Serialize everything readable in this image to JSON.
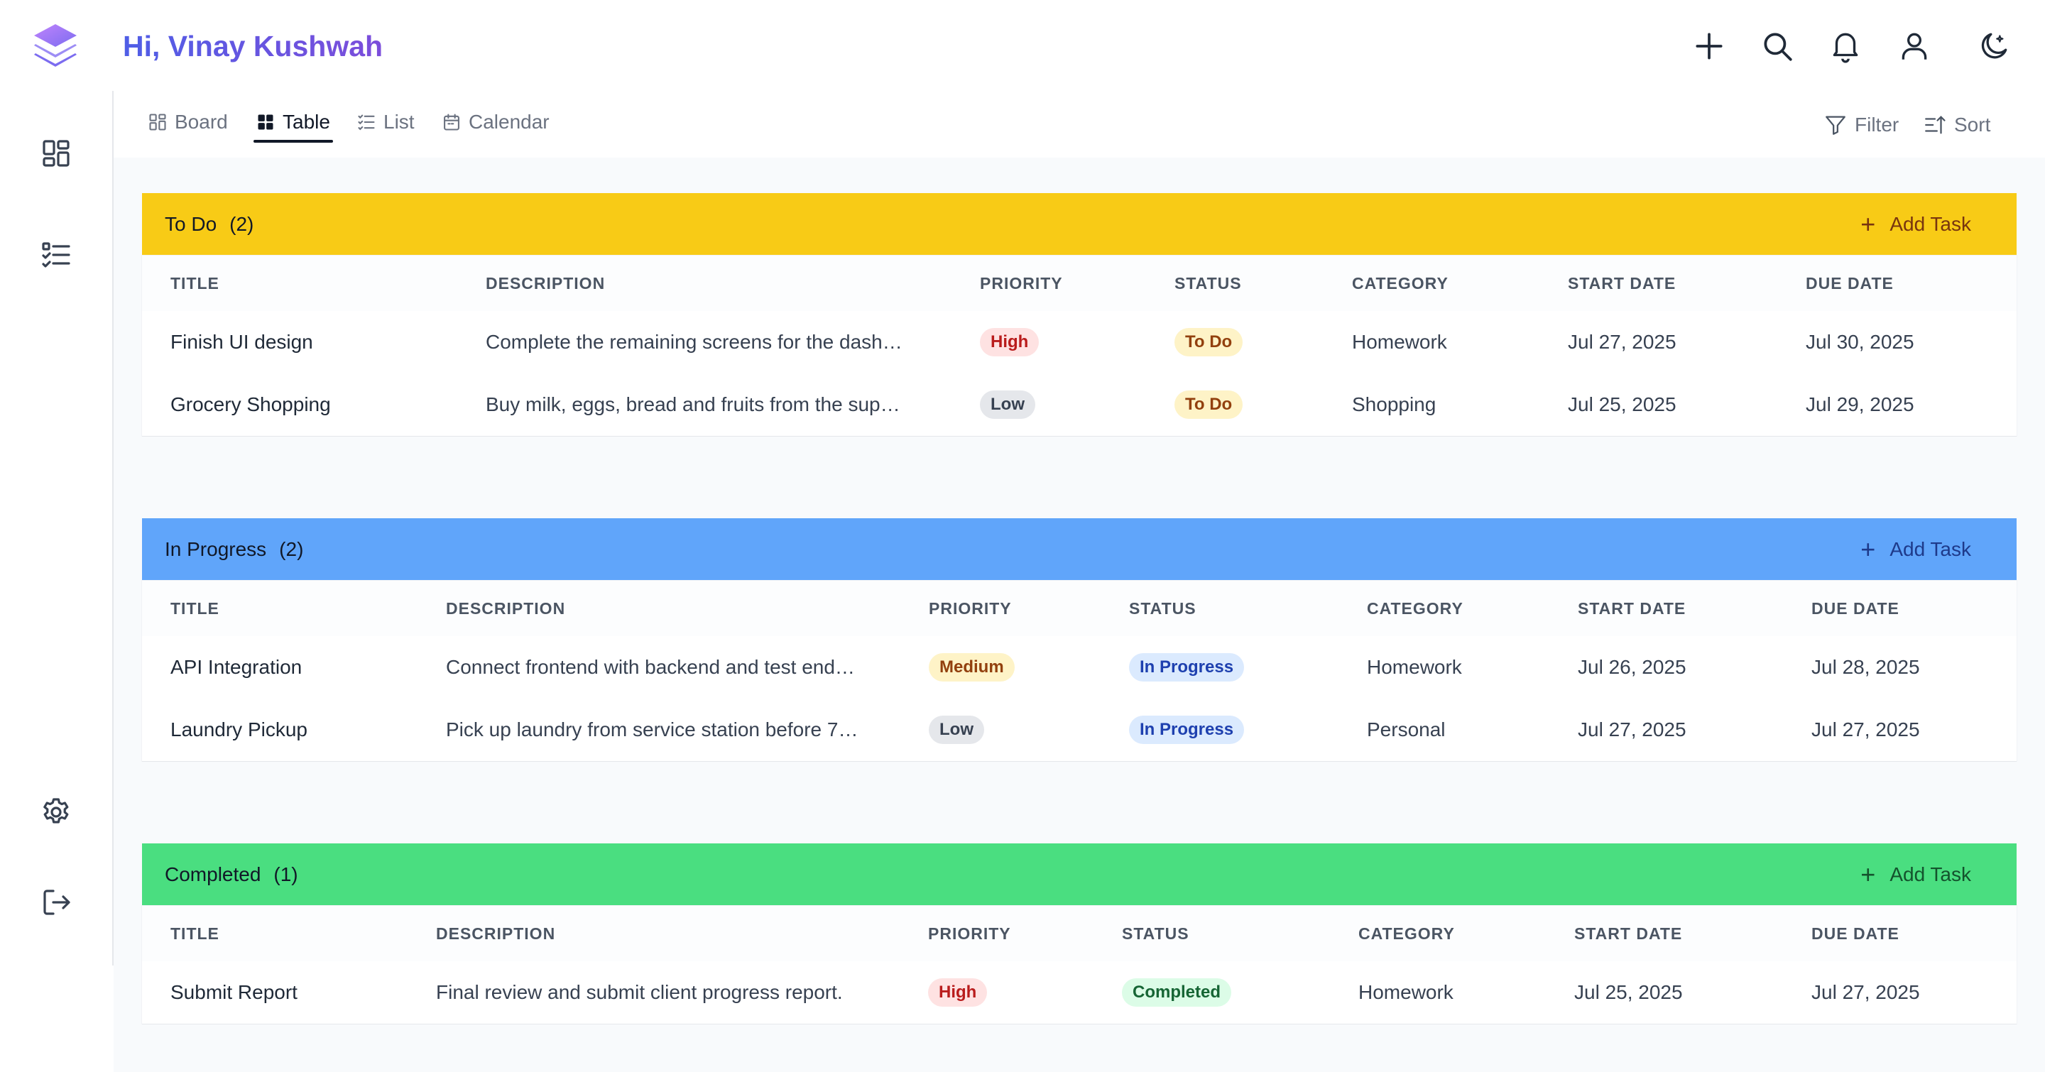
{
  "header": {
    "greeting": "Hi, Vinay Kushwah"
  },
  "header_icons": [
    "plus-icon",
    "search-icon",
    "bell-icon",
    "user-icon",
    "moon-icon"
  ],
  "sidebar_icons": [
    "dashboard-grid-icon",
    "task-list-icon",
    "settings-gear-icon",
    "logout-icon"
  ],
  "tabs": [
    {
      "label": "Board",
      "icon": "board-icon",
      "active": false
    },
    {
      "label": "Table",
      "icon": "table-icon",
      "active": true
    },
    {
      "label": "List",
      "icon": "list-icon",
      "active": false
    },
    {
      "label": "Calendar",
      "icon": "calendar-icon",
      "active": false
    }
  ],
  "toolbar": {
    "filter_label": "Filter",
    "sort_label": "Sort"
  },
  "columns": [
    "TITLE",
    "DESCRIPTION",
    "PRIORITY",
    "STATUS",
    "CATEGORY",
    "START DATE",
    "DUE DATE"
  ],
  "add_task_label": "Add Task",
  "colors": {
    "todo_header": "#f8cb16",
    "in_progress_header": "#60a5fa",
    "completed_header": "#4ade80",
    "priority_high_bg": "#fee2e2",
    "priority_high_fg": "#b91c1c",
    "priority_medium_bg": "#fef3c7",
    "priority_medium_fg": "#92400e",
    "priority_low_bg": "#e5e7eb",
    "priority_low_fg": "#374151",
    "status_todo_bg": "#fef3c7",
    "status_todo_fg": "#92400e",
    "status_progress_bg": "#dbeafe",
    "status_progress_fg": "#1e40af",
    "status_completed_bg": "#dcfce7",
    "status_completed_fg": "#166534"
  },
  "groups": [
    {
      "name": "To Do",
      "count": "(2)",
      "tasks": [
        {
          "title": "Finish UI design",
          "description": "Complete the remaining screens for the dash…",
          "priority": "High",
          "status": "To Do",
          "category": "Homework",
          "start_date": "Jul 27, 2025",
          "due_date": "Jul 30, 2025"
        },
        {
          "title": "Grocery Shopping",
          "description": "Buy milk, eggs, bread and fruits from the sup…",
          "priority": "Low",
          "status": "To Do",
          "category": "Shopping",
          "start_date": "Jul 25, 2025",
          "due_date": "Jul 29, 2025"
        }
      ]
    },
    {
      "name": "In Progress",
      "count": "(2)",
      "tasks": [
        {
          "title": "API Integration",
          "description": "Connect frontend with backend and test end…",
          "priority": "Medium",
          "status": "In Progress",
          "category": "Homework",
          "start_date": "Jul 26, 2025",
          "due_date": "Jul 28, 2025"
        },
        {
          "title": "Laundry Pickup",
          "description": "Pick up laundry from service station before 7…",
          "priority": "Low",
          "status": "In Progress",
          "category": "Personal",
          "start_date": "Jul 27, 2025",
          "due_date": "Jul 27, 2025"
        }
      ]
    },
    {
      "name": "Completed",
      "count": "(1)",
      "tasks": [
        {
          "title": "Submit Report",
          "description": "Final review and submit client progress report.",
          "priority": "High",
          "status": "Completed",
          "category": "Homework",
          "start_date": "Jul 25, 2025",
          "due_date": "Jul 27, 2025"
        }
      ]
    }
  ]
}
